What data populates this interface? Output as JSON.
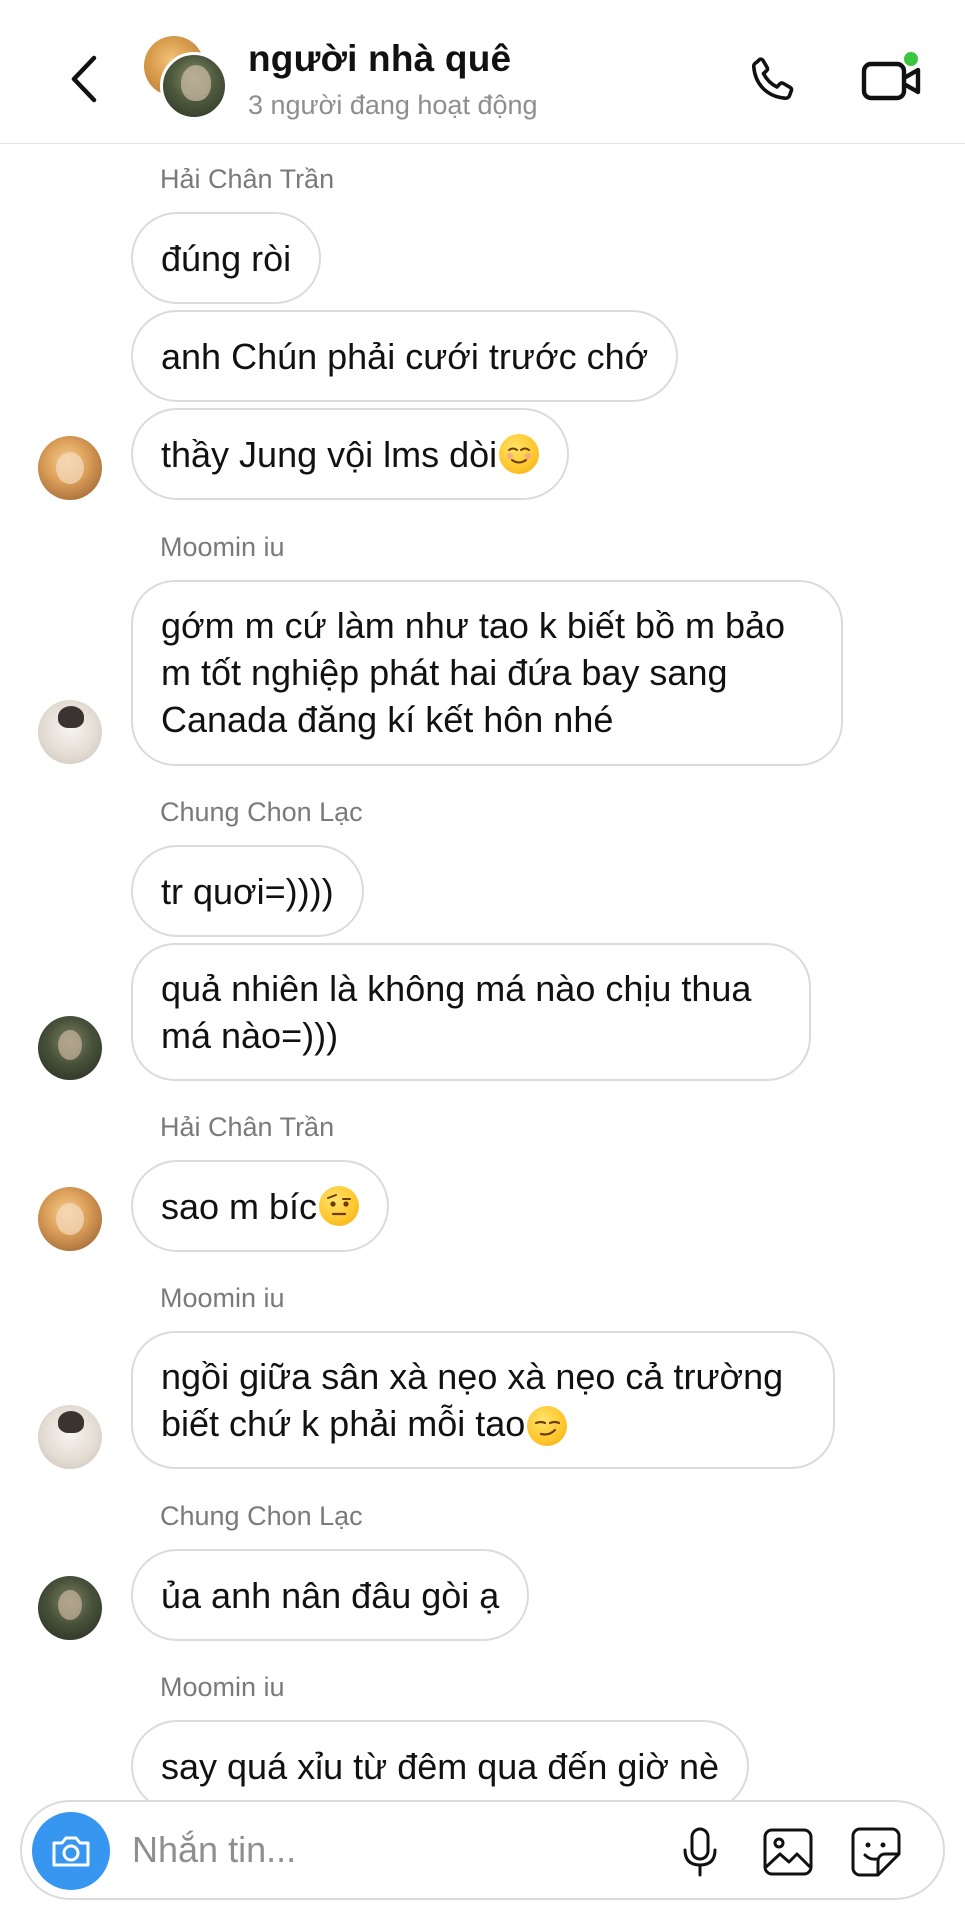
{
  "header": {
    "title": "người nhà quê",
    "subtitle": "3 người đang hoạt động"
  },
  "messages": [
    {
      "sender": "Hải Chân Trần",
      "texts": [
        "đúng ròi",
        "anh Chún phải cưới trước chớ",
        "thầy Jung vội lms dòi"
      ]
    },
    {
      "sender": "Moomin iu",
      "texts": [
        "gớm m cứ làm như tao k biết bồ m bảo m tốt nghiệp phát hai đứa bay sang Canada đăng kí kết hôn nhé"
      ]
    },
    {
      "sender": "Chung Chon Lạc",
      "texts": [
        "tr quơi=))))",
        "quả nhiên là không má nào chịu thua má nào=)))"
      ]
    },
    {
      "sender": "Hải Chân Trần",
      "texts": [
        "sao m bíc"
      ]
    },
    {
      "sender": "Moomin iu",
      "texts": [
        "ngồi giữa sân xà nẹo xà nẹo cả trường biết chứ k phải mỗi tao"
      ]
    },
    {
      "sender": "Chung Chon Lạc",
      "texts": [
        "ủa anh nân đâu gòi ạ"
      ]
    },
    {
      "sender": "Moomin iu",
      "texts": [
        "say quá xỉu từ đêm qua đến giờ nè"
      ]
    }
  ],
  "composer": {
    "placeholder": "Nhắn tin..."
  },
  "icons": {
    "back": "chevron-left-icon",
    "call": "phone-icon",
    "video": "video-camera-icon",
    "camera": "camera-icon",
    "mic": "microphone-icon",
    "gallery": "image-icon",
    "sticker": "sticker-icon",
    "emoji_relieved": "relieved-face-emoji",
    "emoji_raised_eyebrow": "raised-eyebrow-emoji",
    "emoji_smirk": "smirking-face-emoji"
  },
  "colors": {
    "accent": "#3797f0",
    "online": "#3ac640",
    "bubble_border": "#dbdbdb",
    "secondary_text": "#8e8e8e"
  }
}
